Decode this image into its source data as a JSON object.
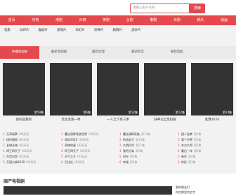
{
  "search": {
    "placeholder": "请输入影片名称",
    "button": "搜索"
  },
  "nav": [
    "首页",
    "内地",
    "港剧",
    "日韩",
    "美剧",
    "台剧",
    "泰剧",
    "日剧",
    "韩片",
    "动画"
  ],
  "categories": [
    "电影",
    "动作片",
    "喜剧片",
    "爱情片",
    "科幻片",
    "恐怖片",
    "剧情片",
    "战争片"
  ],
  "tabs": [
    "热播电视剧",
    "最新电视剧",
    "最新动漫",
    "最新综艺",
    "最新电影"
  ],
  "cards": [
    {
      "title": "妈妈是我的",
      "badge": "第59集"
    },
    {
      "title": "黑化黑第一季",
      "badge": "第6集"
    },
    {
      "title": "一人之下第三季",
      "badge": "第12集"
    },
    {
      "title": "妖神记之黑狱篇",
      "badge": "第12集"
    },
    {
      "title": "赴豫2020",
      "badge": "第20集"
    }
  ],
  "lists": [
    [
      {
        "title": "天奇绿萝",
        "tag": "HD高清"
      },
      {
        "title": "绿色情网",
        "tag": "HD高清"
      },
      {
        "title": "长城长城",
        "tag": "HD高清"
      },
      {
        "title": "四王四天子",
        "tag": "HD高清"
      },
      {
        "title": "东宫内宫",
        "tag": "HD高清"
      },
      {
        "title": "开国大典2019",
        "tag": "HD高清"
      }
    ],
    [
      {
        "title": "魔法清辉家族世界",
        "tag": "HD高清"
      },
      {
        "title": "博弈2020",
        "tag": "HD高清"
      },
      {
        "title": "双城的星",
        "tag": "HD高清"
      },
      {
        "title": "四王四天子",
        "tag": "HD高清"
      },
      {
        "title": "天气之子",
        "tag": "HD高清"
      },
      {
        "title": "巴比伦",
        "tag": "HD高清"
      }
    ],
    [
      {
        "title": "魔法清辉家族",
        "tag": "第12集"
      },
      {
        "title": "奶油女王",
        "tag": "第13集"
      },
      {
        "title": "大明风华",
        "tag": "第21集"
      },
      {
        "title": "我的兄弟",
        "tag": "第9集"
      },
      {
        "title": "时光",
        "tag": "第6集"
      },
      {
        "title": "幸福",
        "tag": "第5集"
      }
    ],
    [
      {
        "title": "国人说梦",
        "tag": "第1集"
      },
      {
        "title": "第个世界",
        "tag": "第6集"
      },
      {
        "title": "东方大哥",
        "tag": "第2集"
      },
      {
        "title": "最后一年",
        "tag": "第2集"
      },
      {
        "title": "新年",
        "tag": "第4集"
      },
      {
        "title": "你好",
        "tag": "第3集"
      }
    ]
  ],
  "section": {
    "title": "国产电视剧",
    "items": [
      "我的朋友们",
      "你在哪里的名字"
    ]
  }
}
